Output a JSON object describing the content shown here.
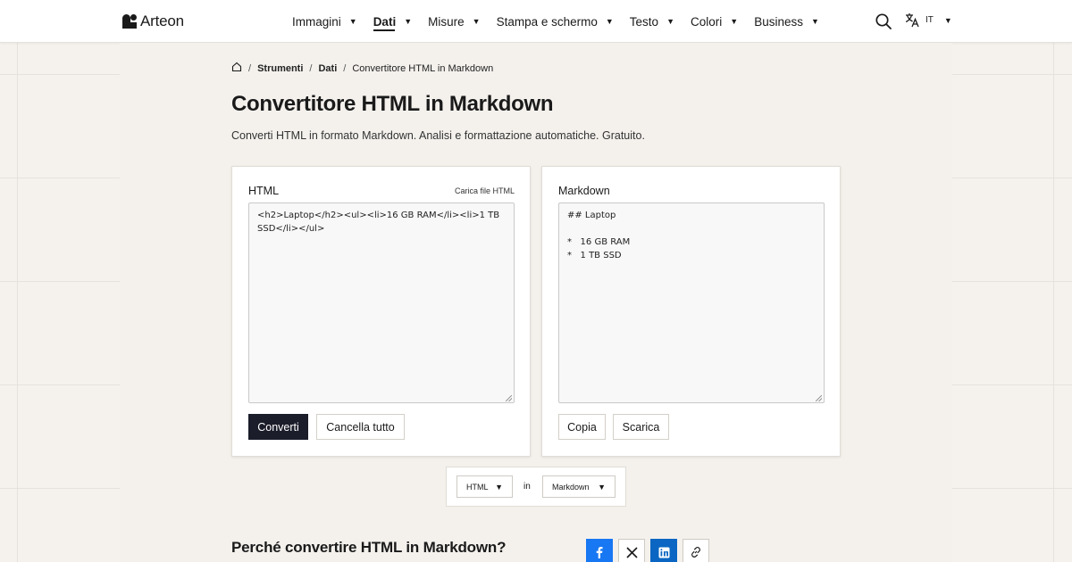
{
  "brand": {
    "name": "Arteon"
  },
  "nav": {
    "items": [
      {
        "label": "Immagini"
      },
      {
        "label": "Dati"
      },
      {
        "label": "Misure"
      },
      {
        "label": "Stampa e schermo"
      },
      {
        "label": "Testo"
      },
      {
        "label": "Colori"
      },
      {
        "label": "Business"
      }
    ],
    "active": "Dati",
    "caret": "▼",
    "language": "IT"
  },
  "breadcrumb": {
    "items": [
      "Strumenti",
      "Dati",
      "Convertitore HTML in Markdown"
    ],
    "separator": "/"
  },
  "page": {
    "title": "Convertitore HTML in Markdown",
    "subtitle": "Converti HTML in formato Markdown. Analisi e formattazione automatiche. Gratuito."
  },
  "input_panel": {
    "label": "HTML",
    "upload_label": "Carica file HTML",
    "value": "<h2>Laptop</h2><ul><li>16 GB RAM</li><li>1 TB SSD</li></ul>",
    "convert_label": "Converti",
    "clear_label": "Cancella tutto"
  },
  "output_panel": {
    "label": "Markdown",
    "value": "## Laptop\n\n*   16 GB RAM\n*   1 TB SSD",
    "copy_label": "Copia",
    "download_label": "Scarica"
  },
  "format_bar": {
    "from": "HTML",
    "joiner": "in",
    "to": "Markdown"
  },
  "section": {
    "why_title": "Perché convertire HTML in Markdown?"
  },
  "colors": {
    "primary_button": "#1b1d2a",
    "facebook": "#1877f2",
    "linkedin": "#0a66c2"
  },
  "icons": [
    "logo-icon",
    "search-icon",
    "translate-icon",
    "home-icon",
    "facebook-icon",
    "x-icon",
    "linkedin-icon",
    "link-icon"
  ]
}
